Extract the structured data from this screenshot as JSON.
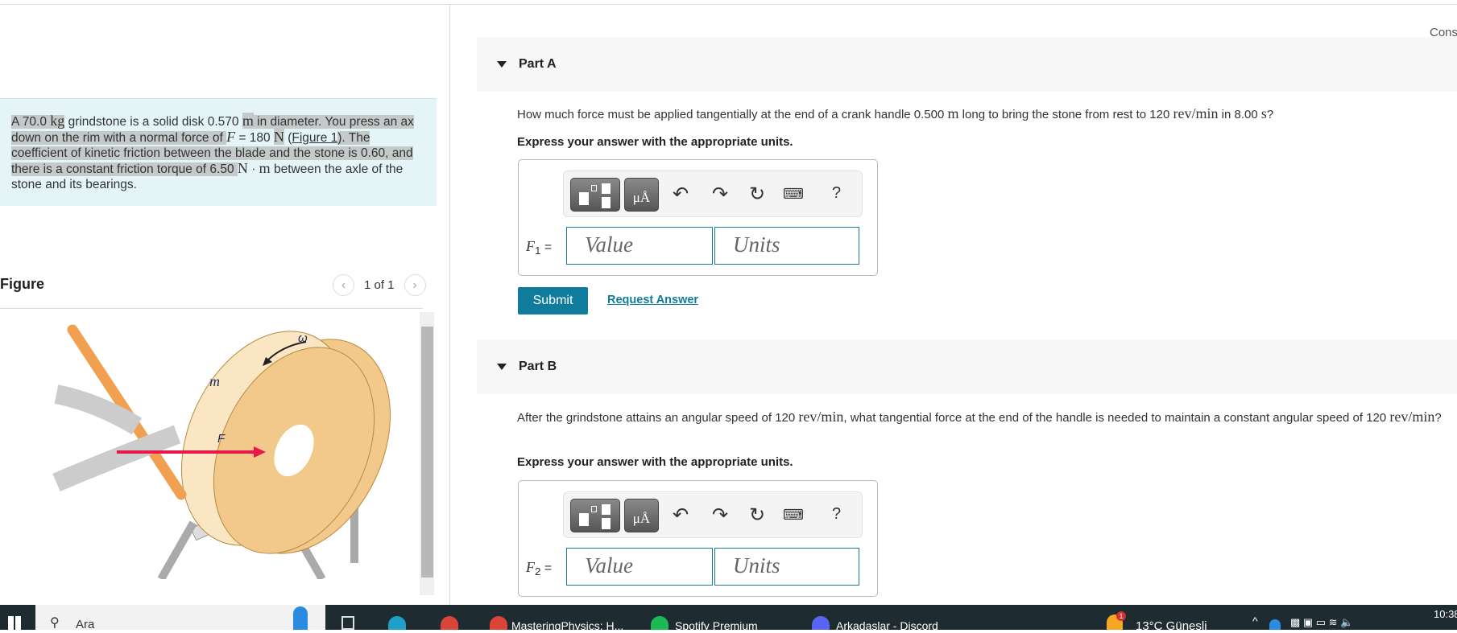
{
  "problem": {
    "segments": [
      "A 70.0 ",
      "kg",
      " grindstone is a solid disk 0.570 ",
      "m",
      " in diameter. You press an ax down on the rim with a normal force of ",
      "F",
      " = 180 ",
      "N",
      " (",
      "Figure 1",
      "). The coefficient of kinetic friction between the blade and the stone is 0.60, and there is a constant friction torque of 6.50 ",
      "N",
      " · ",
      "m",
      " between the axle of the stone and its bearings."
    ]
  },
  "figure": {
    "title": "Figure",
    "pager": "1 of 1",
    "labels": {
      "mass": "m",
      "omega": "ω",
      "force": "F"
    },
    "prev_icon": "chevron-left-icon",
    "next_icon": "chevron-right-icon"
  },
  "header_link": "Cons",
  "partA": {
    "label": "Part A",
    "question": [
      "How much force must be applied tangentially at the end of a crank handle 0.500 ",
      "m",
      " long to bring the stone from rest to 120 ",
      "rev/min",
      " in 8.00 ",
      "s",
      "?"
    ],
    "instruction": "Express your answer with the appropriate units.",
    "var_label": "F",
    "var_sub": "1",
    "value_placeholder": "Value",
    "units_placeholder": "Units",
    "submit": "Submit",
    "request": "Request Answer"
  },
  "partB": {
    "label": "Part B",
    "question": [
      "After the grindstone attains an angular speed of 120 ",
      "rev/min",
      ", what tangential force at the end of the handle is needed to maintain a constant angular speed of 120 ",
      "rev/min",
      "?"
    ],
    "instruction": "Express your answer with the appropriate units.",
    "var_label": "F",
    "var_sub": "2",
    "value_placeholder": "Value",
    "units_placeholder": "Units"
  },
  "toolbar": {
    "units_btn": "μÅ",
    "help": "?"
  },
  "taskbar": {
    "search": "Ara",
    "apps": [
      "MasteringPhysics: H...",
      "Spotify Premium",
      "Arkadaslar - Discord"
    ],
    "weather": "13°C  Güneşli",
    "badge": "1",
    "time": "10:38"
  },
  "colors": {
    "accent": "#0f7c9e",
    "problem_bg": "#e5f5f7",
    "force_arrow": "#e8194a",
    "stone": "#f2c98a"
  }
}
